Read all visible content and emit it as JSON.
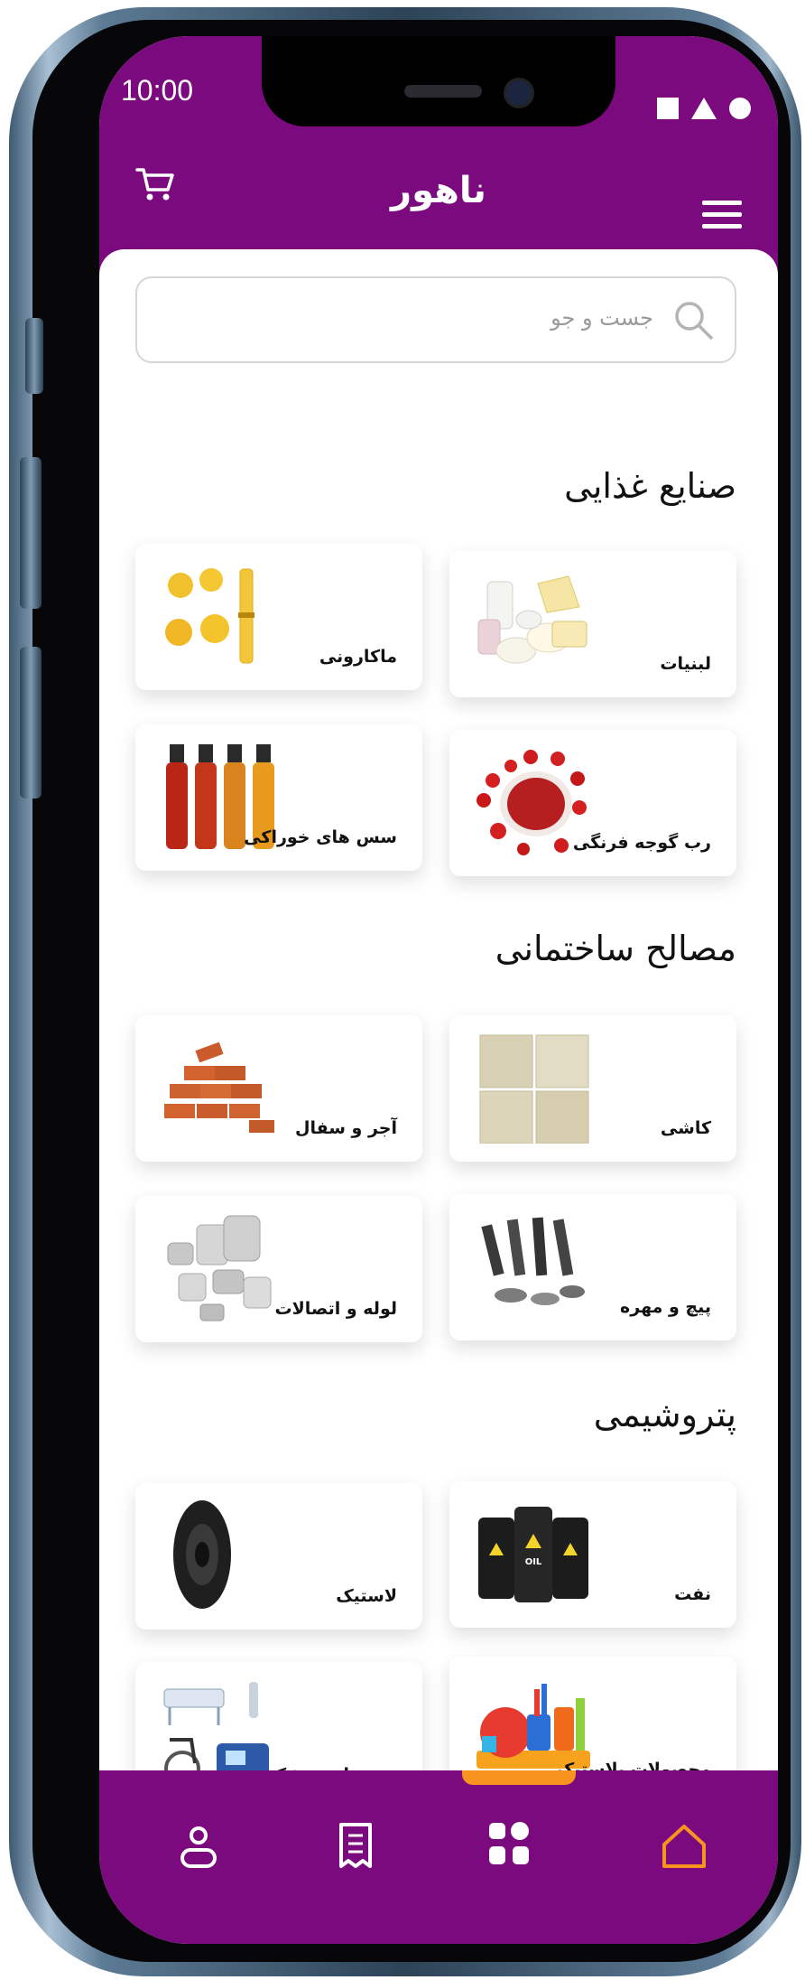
{
  "status_bar": {
    "time": "10:00"
  },
  "header": {
    "title": "ناهور"
  },
  "search": {
    "placeholder": "جست و جو"
  },
  "sections": [
    {
      "title": "صنایع غذایی",
      "items": [
        "لبنیات",
        "ماکارونی",
        "رب گوجه فرنگی",
        "سس های خوراکی"
      ]
    },
    {
      "title": "مصالح ساختمانی",
      "items": [
        "کاشی",
        "آجر و سفال",
        "پیچ و مهره",
        "لوله و اتصالات"
      ]
    },
    {
      "title": "پتروشیمی",
      "items": [
        "نفت",
        "لاستیک",
        "محصولات پلاستیکی",
        "تجهیزات پزشکی"
      ]
    }
  ],
  "bottom_nav": {
    "items": [
      "home-icon",
      "categories-icon",
      "orders-icon",
      "profile-icon"
    ],
    "active": "home-icon"
  },
  "colors": {
    "brand": "#7a0a7d",
    "accent": "#f7931e",
    "oil_label": "OIL"
  }
}
